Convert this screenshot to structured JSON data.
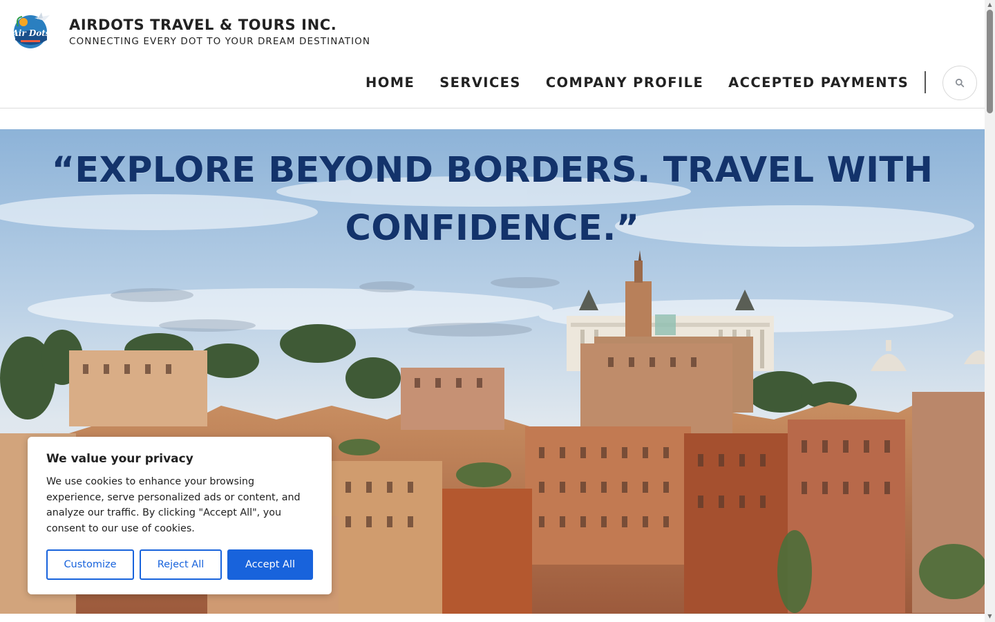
{
  "header": {
    "logo_text": "Air Dots",
    "title": "AIRDOTS TRAVEL & TOURS INC.",
    "tagline": "CONNECTING EVERY DOT TO YOUR DREAM DESTINATION"
  },
  "nav": {
    "items": [
      {
        "label": "HOME"
      },
      {
        "label": "SERVICES"
      },
      {
        "label": "COMPANY PROFILE"
      },
      {
        "label": "ACCEPTED PAYMENTS"
      }
    ],
    "search_icon": "search-icon"
  },
  "hero": {
    "quote_line1": "“EXPLORE BEYOND BORDERS. TRAVEL WITH",
    "quote_line2": "CONFIDENCE.”"
  },
  "cookie": {
    "title": "We value your privacy",
    "text": "We use cookies to enhance your browsing experience, serve personalized ads or content, and analyze our traffic. By clicking \"Accept All\", you consent to our use of cookies.",
    "customize_label": "Customize",
    "reject_label": "Reject All",
    "accept_label": "Accept All"
  },
  "colors": {
    "quote": "#13336b",
    "accent_blue": "#1863dc"
  }
}
